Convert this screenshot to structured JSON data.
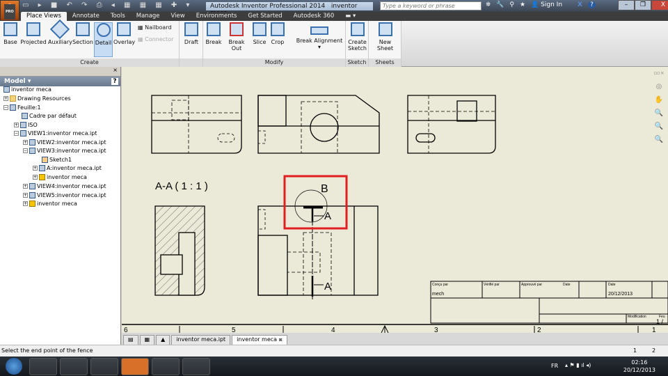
{
  "titlebar": {
    "app_logo": "I",
    "app_logo_sub": "PRO",
    "title": "Autodesk Inventor Professional 2014",
    "document": "inventor meca",
    "search_placeholder": "Type a keyword or phrase",
    "sign_in": "Sign In",
    "help": "?",
    "minimize": "–",
    "restore": "❐",
    "close": "X"
  },
  "ribbon_tabs": [
    "Place Views",
    "Annotate",
    "Tools",
    "Manage",
    "View",
    "Environments",
    "Get Started",
    "Autodesk 360"
  ],
  "ribbon": {
    "create": {
      "label": "Create",
      "buttons": [
        "Base",
        "Projected",
        "Auxiliary",
        "Section",
        "Detail",
        "Overlay"
      ],
      "nailboard": "Nailboard",
      "connector": "Connector"
    },
    "draft": "Draft",
    "modify": {
      "label": "Modify",
      "buttons": [
        "Break",
        "Break Out",
        "Slice",
        "Crop"
      ],
      "break_alignment": "Break Alignment"
    },
    "sketch": {
      "label": "Sketch",
      "button": "Create Sketch"
    },
    "sheets": {
      "label": "Sheets",
      "button": "New Sheet"
    }
  },
  "browser": {
    "title": "Model ▾",
    "help": "?",
    "nodes": [
      "inventor meca",
      "Drawing Resources",
      "Feuille:1",
      "Cadre par défaut",
      "ISO",
      "VIEW1:inventor meca.ipt",
      "VIEW2:inventor meca.ipt",
      "VIEW3:inventor meca.ipt",
      "Sketch1",
      "A:inventor meca.ipt",
      "inventor meca",
      "VIEW4:inventor meca.ipt",
      "VIEW5:inventor meca.ipt",
      "inventor meca"
    ]
  },
  "drawing": {
    "section_label": "A-A ( 1 : 1 )",
    "detail_label": "B",
    "section_arrow_1": "A",
    "section_arrow_2": "A",
    "ruler": [
      "6",
      "5",
      "4",
      "3",
      "2",
      "1"
    ],
    "title_block": {
      "concu_par": "Conçu par",
      "concu_value": "mech",
      "verifie_par": "Vérifié par",
      "approuve_par": "Approuvé par",
      "date1": "Date",
      "date2": "Date",
      "date_value": "20/12/2013",
      "modification": "Modification",
      "feuille": "Feu",
      "sheet_value": "1 /"
    }
  },
  "doc_tabs": [
    "inventor meca.ipt",
    "inventor meca"
  ],
  "status": {
    "message": "Select the end point of the fence",
    "n1": "1",
    "n2": "2"
  },
  "taskbar": {
    "lang": "FR",
    "time": "02:16",
    "date": "20/12/2013"
  },
  "colors": {
    "canvas": "#ebe9d7",
    "highlight": "#e02020"
  }
}
